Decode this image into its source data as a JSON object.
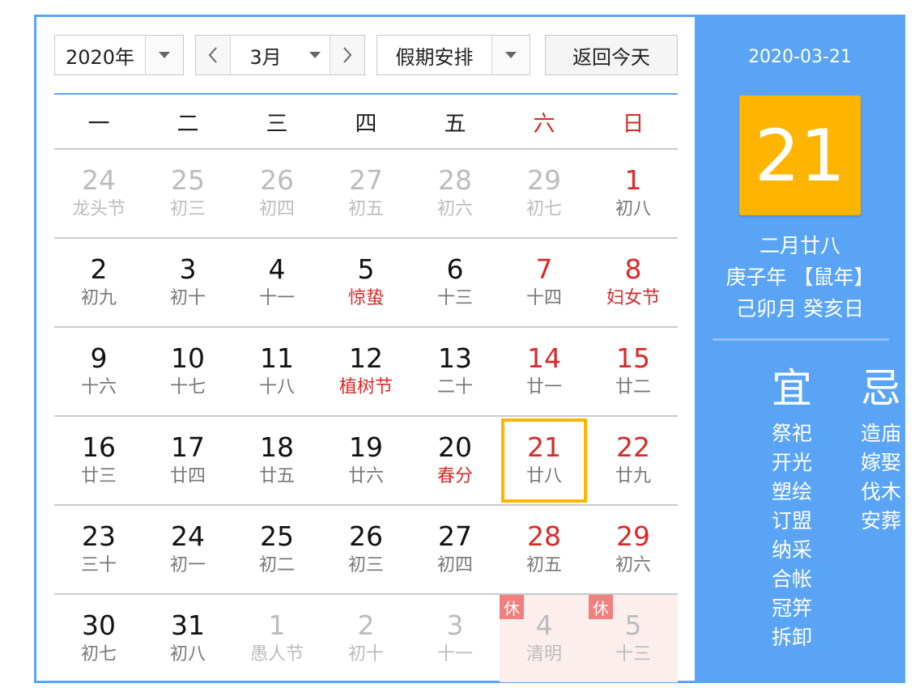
{
  "toolbar": {
    "year": "2020年",
    "month": "3月",
    "holiday": "假期安排",
    "today_label": "返回今天"
  },
  "weekdays": [
    "一",
    "二",
    "三",
    "四",
    "五",
    "六",
    "日"
  ],
  "weeks": [
    [
      {
        "num": "24",
        "lunar": "龙头节",
        "other": true
      },
      {
        "num": "25",
        "lunar": "初三",
        "other": true
      },
      {
        "num": "26",
        "lunar": "初四",
        "other": true
      },
      {
        "num": "27",
        "lunar": "初五",
        "other": true
      },
      {
        "num": "28",
        "lunar": "初六",
        "other": true
      },
      {
        "num": "29",
        "lunar": "初七",
        "other": true
      },
      {
        "num": "1",
        "lunar": "初八",
        "weekend": true
      }
    ],
    [
      {
        "num": "2",
        "lunar": "初九"
      },
      {
        "num": "3",
        "lunar": "初十"
      },
      {
        "num": "4",
        "lunar": "十一"
      },
      {
        "num": "5",
        "lunar": "惊蛰",
        "festival": true
      },
      {
        "num": "6",
        "lunar": "十三"
      },
      {
        "num": "7",
        "lunar": "十四",
        "weekend": true
      },
      {
        "num": "8",
        "lunar": "妇女节",
        "weekend": true,
        "festival": true
      }
    ],
    [
      {
        "num": "9",
        "lunar": "十六"
      },
      {
        "num": "10",
        "lunar": "十七"
      },
      {
        "num": "11",
        "lunar": "十八"
      },
      {
        "num": "12",
        "lunar": "植树节",
        "festival": true
      },
      {
        "num": "13",
        "lunar": "二十"
      },
      {
        "num": "14",
        "lunar": "廿一",
        "weekend": true
      },
      {
        "num": "15",
        "lunar": "廿二",
        "weekend": true
      }
    ],
    [
      {
        "num": "16",
        "lunar": "廿三"
      },
      {
        "num": "17",
        "lunar": "廿四"
      },
      {
        "num": "18",
        "lunar": "廿五"
      },
      {
        "num": "19",
        "lunar": "廿六"
      },
      {
        "num": "20",
        "lunar": "春分",
        "festival": true
      },
      {
        "num": "21",
        "lunar": "廿八",
        "weekend": true,
        "selected": true
      },
      {
        "num": "22",
        "lunar": "廿九",
        "weekend": true
      }
    ],
    [
      {
        "num": "23",
        "lunar": "三十"
      },
      {
        "num": "24",
        "lunar": "初一"
      },
      {
        "num": "25",
        "lunar": "初二"
      },
      {
        "num": "26",
        "lunar": "初三"
      },
      {
        "num": "27",
        "lunar": "初四"
      },
      {
        "num": "28",
        "lunar": "初五",
        "weekend": true
      },
      {
        "num": "29",
        "lunar": "初六",
        "weekend": true
      }
    ],
    [
      {
        "num": "30",
        "lunar": "初七"
      },
      {
        "num": "31",
        "lunar": "初八"
      },
      {
        "num": "1",
        "lunar": "愚人节",
        "other": true
      },
      {
        "num": "2",
        "lunar": "初十",
        "other": true
      },
      {
        "num": "3",
        "lunar": "十一",
        "other": true
      },
      {
        "num": "4",
        "lunar": "清明",
        "other": true,
        "rest": true,
        "badge": "休"
      },
      {
        "num": "5",
        "lunar": "十三",
        "other": true,
        "rest": true,
        "badge": "休"
      }
    ]
  ],
  "panel": {
    "date": "2020-03-21",
    "day": "21",
    "lunar_date": "二月廿八",
    "ganzhi_year": "庚子年 【鼠年】",
    "ganzhi_day": "己卯月 癸亥日",
    "yi_label": "宜",
    "ji_label": "忌",
    "yi": [
      "祭祀",
      "开光",
      "塑绘",
      "订盟",
      "纳采",
      "合帐",
      "冠笄",
      "拆卸"
    ],
    "ji": [
      "造庙",
      "嫁娶",
      "伐木",
      "安葬"
    ]
  },
  "colors": {
    "accent": "#5aa4f6",
    "highlight": "#ffb400",
    "weekend": "#d92a2a",
    "rest_bg": "#fdeeee",
    "rest_badge": "#f08080"
  }
}
